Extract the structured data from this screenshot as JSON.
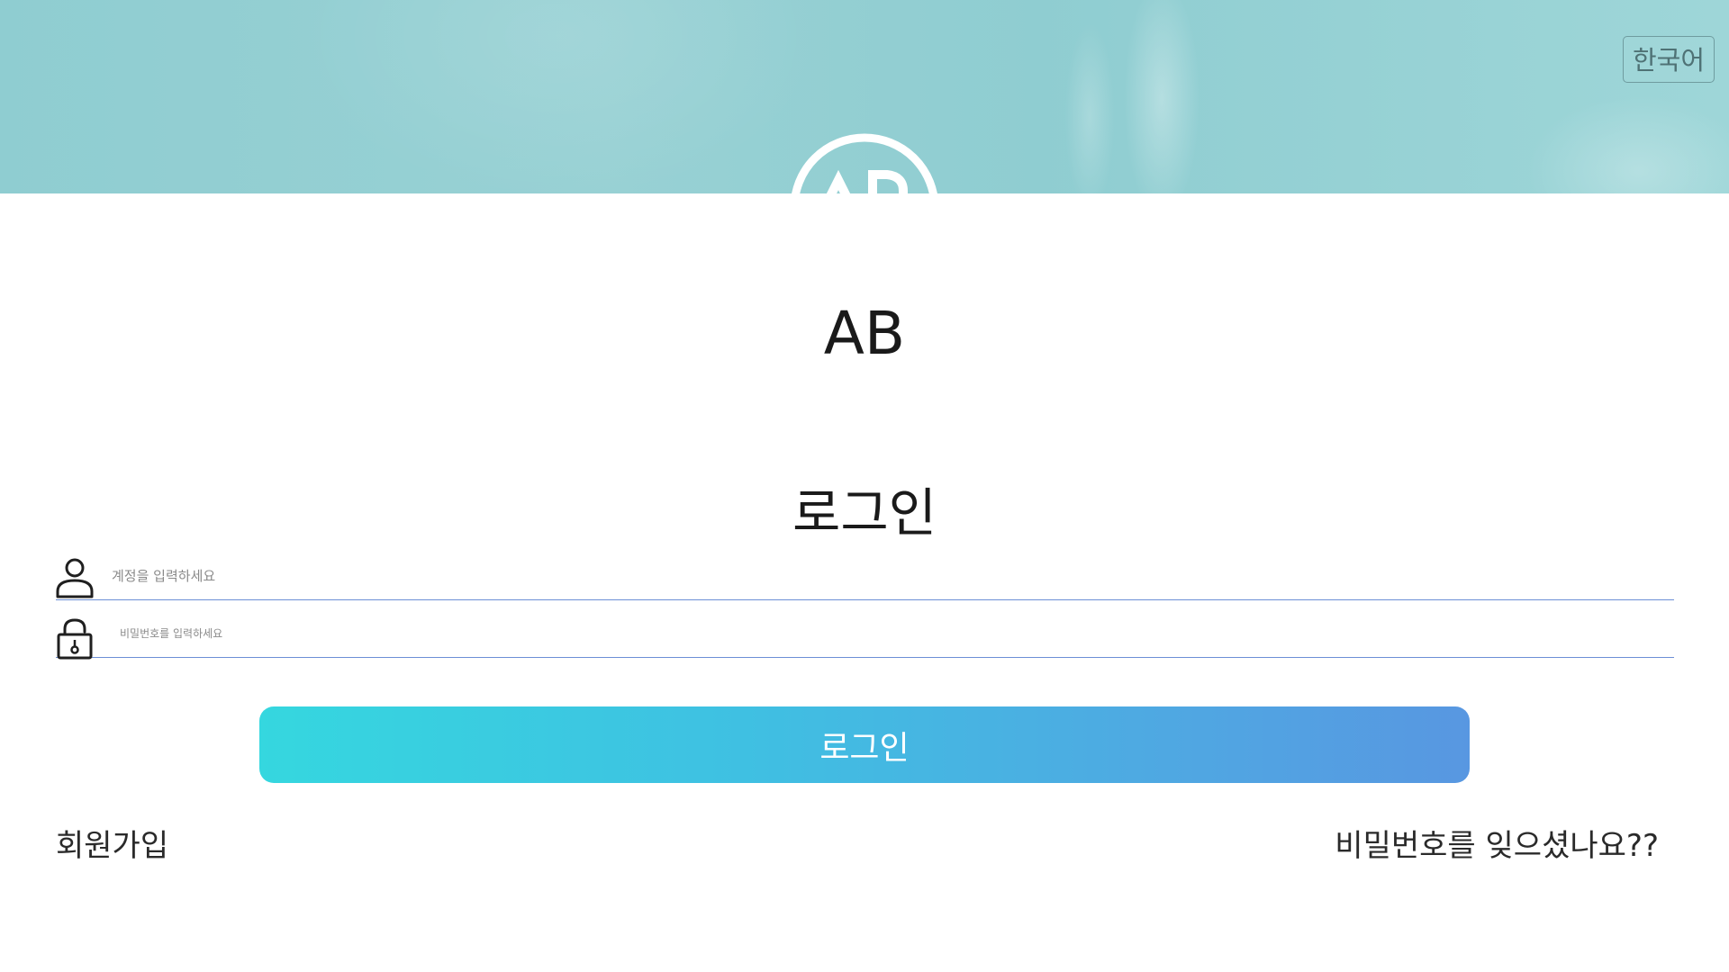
{
  "header": {
    "language_button": "한국어",
    "logo_letters": "AB"
  },
  "main": {
    "app_name": "AB",
    "form_title": "로그인",
    "account_field": {
      "placeholder": "계정을 입력하세요",
      "icon": "user-icon"
    },
    "password_field": {
      "placeholder": "비밀번호를 입력하세요",
      "icon": "lock-icon"
    },
    "login_button": "로그인",
    "signup_link": "회원가입",
    "forgot_password_link": "비밀번호를 잊으셨나요??"
  },
  "colors": {
    "banner": "#8fcdd1",
    "button_gradient_start": "#35d7df",
    "button_gradient_end": "#5897e1",
    "field_underline": "#6c8fd6"
  }
}
